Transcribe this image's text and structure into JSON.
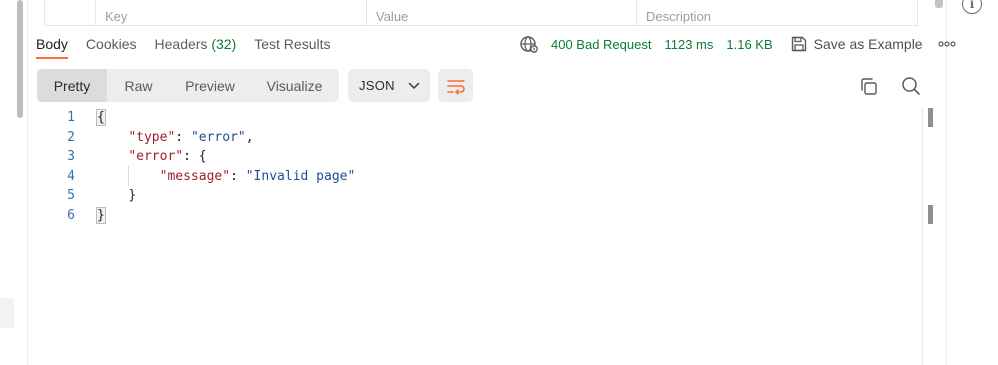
{
  "params_table": {
    "key_header": "Key",
    "value_header": "Value",
    "description_header": "Description"
  },
  "response_tabs": [
    {
      "label": "Body",
      "active": true
    },
    {
      "label": "Cookies",
      "active": false
    },
    {
      "label": "Headers",
      "count": "(32)",
      "active": false
    },
    {
      "label": "Test Results",
      "active": false
    }
  ],
  "response_meta": {
    "status": "400 Bad Request",
    "time": "1123 ms",
    "size": "1.16 KB",
    "save_label": "Save as Example",
    "status_color": "#0b7d3a"
  },
  "view_modes": [
    "Pretty",
    "Raw",
    "Preview",
    "Visualize"
  ],
  "selected_view": "Pretty",
  "format": "JSON",
  "accent_color": "#ff6c37",
  "icons": [
    "info-icon",
    "globe-icon",
    "save-icon",
    "more-icon",
    "chevron-down-icon",
    "wrap-lines-icon",
    "copy-icon",
    "search-icon"
  ],
  "code_lines": [
    {
      "num": "1",
      "text": "{"
    },
    {
      "num": "2",
      "key": "\"type\"",
      "value": "\"error\"",
      "suffix": ","
    },
    {
      "num": "3",
      "key": "\"error\"",
      "suffix": ": {"
    },
    {
      "num": "4",
      "key": "\"message\"",
      "value": "\"Invalid page\""
    },
    {
      "num": "5",
      "text": "}"
    },
    {
      "num": "6",
      "text": "}"
    }
  ]
}
